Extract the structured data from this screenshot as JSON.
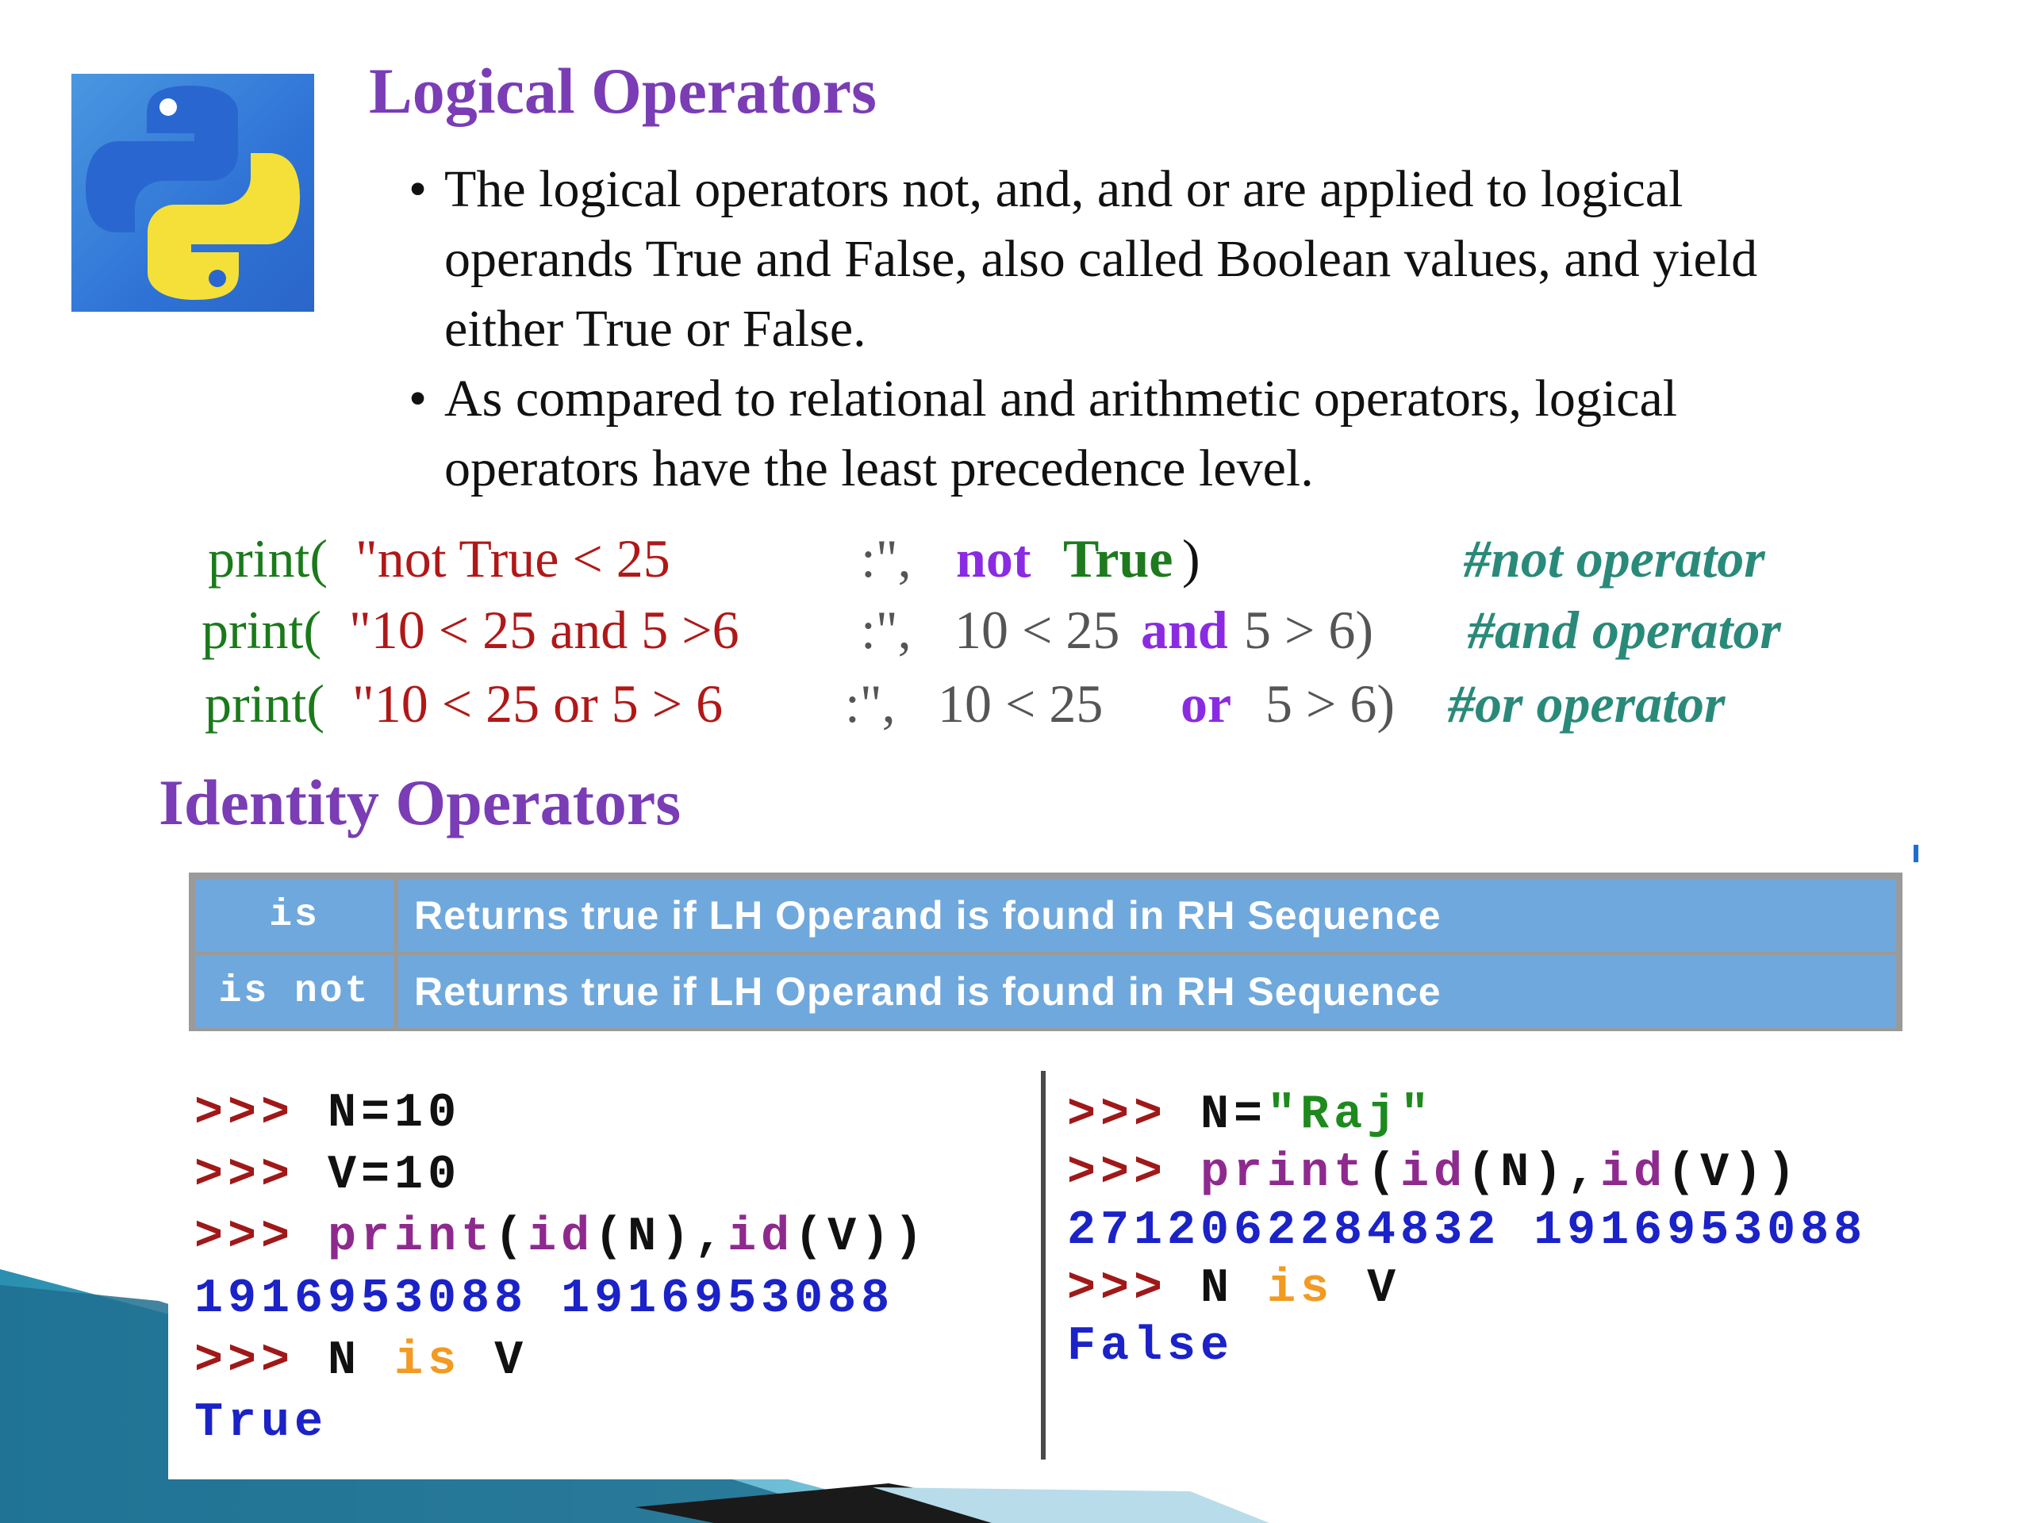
{
  "slide": {
    "title": "Logical Operators",
    "bullets": [
      [
        "The logical operators not, and, and or are applied to logical",
        "operands True and False, also  called Boolean values, and yield",
        "either True or False."
      ],
      [
        "As compared to relational and arithmetic operators, logical",
        "operators have the least precedence level."
      ]
    ],
    "code_lines": [
      {
        "print": "print(",
        "string": "\"not True < 25",
        "colon": ":\",",
        "expr_kw1": "not",
        "expr_kw2": "True",
        "expr_close": ")",
        "comment": "#not operator"
      },
      {
        "print": "print(",
        "string": "\"10 < 25 and 5 >6",
        "colon": ":\",",
        "expr_pre": "10 < 25",
        "expr_kw": "and",
        "expr_post": "5 > 6)",
        "comment": "#and operator"
      },
      {
        "print": "print(",
        "string": "\"10 < 25 or 5 > 6",
        "colon": ":\",",
        "expr_pre": "10  <  25",
        "expr_kw": "or",
        "expr_post": "5 >  6)",
        "comment": "#or operator"
      }
    ],
    "identity_title": "Identity Operators",
    "identity_table": [
      {
        "op": "is",
        "desc": "Returns true if LH Operand is found in RH Sequence"
      },
      {
        "op": "is not",
        "desc": "Returns true if LH Operand is found in RH Sequence"
      }
    ],
    "console_left": {
      "prompt": ">>>",
      "l1": "N=10",
      "l2": "V=10",
      "l3_fn": "print",
      "l3_open": "(",
      "l3_id1": "id",
      "l3_mid": "(N),",
      "l3_id2": "id",
      "l3_end": "(V))",
      "l4": "1916953088 1916953088",
      "l5_a": "N",
      "l5_is": "is",
      "l5_b": "V",
      "l6": "True"
    },
    "console_right": {
      "prompt": ">>>",
      "l1_a": "N=",
      "l1_str": "\"Raj\"",
      "l2_fn": "print",
      "l2_open": "(",
      "l2_id1": "id",
      "l2_mid": "(N),",
      "l2_id2": "id",
      "l2_end": "(V))",
      "l3": "2712062284832 1916953088",
      "l4_a": "N",
      "l4_is": "is",
      "l4_b": "V",
      "l5": "False"
    }
  }
}
